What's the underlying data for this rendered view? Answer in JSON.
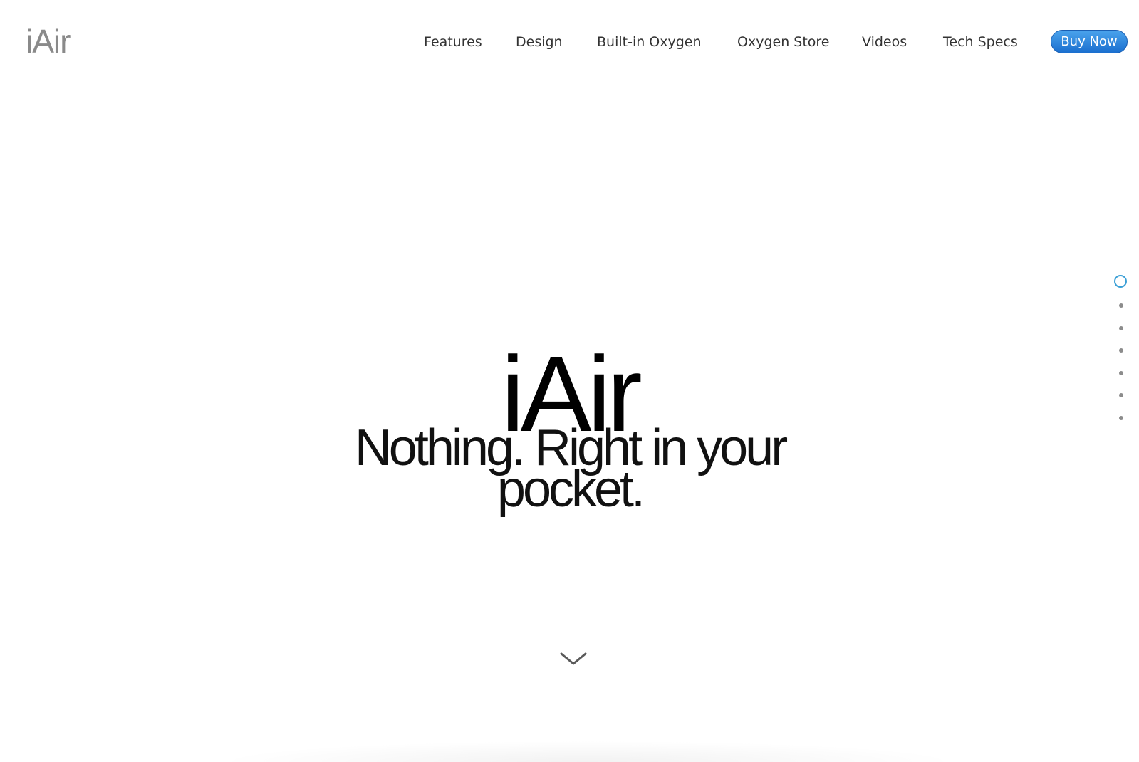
{
  "header": {
    "logo": "iAir",
    "nav": {
      "features": "Features",
      "design": "Design",
      "oxygen": "Built-in Oxygen",
      "store": "Oxygen Store",
      "videos": "Videos",
      "specs": "Tech Specs"
    },
    "buy_label": "Buy Now"
  },
  "hero": {
    "title": "iAir",
    "subtitle": "Nothing. Right in your pocket."
  },
  "side_nav": {
    "sections": 7,
    "active_index": 0
  },
  "colors": {
    "accent": "#3a9fd6",
    "buy_button": "#1b6fcf",
    "logo": "#8a8a8a"
  },
  "icons": {
    "scroll": "chevron-down-icon"
  }
}
